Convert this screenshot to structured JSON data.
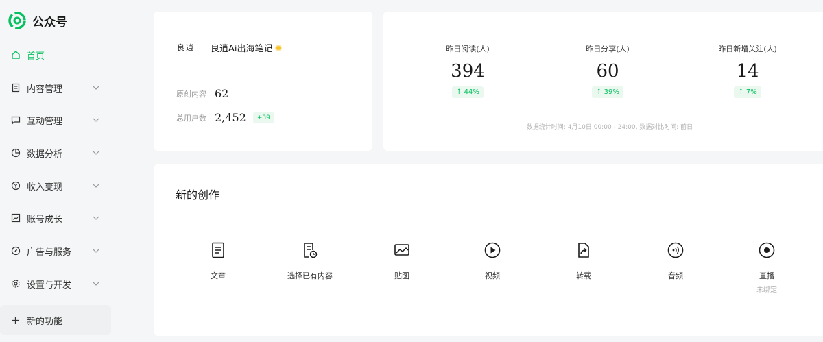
{
  "app": {
    "title": "公众号"
  },
  "sidebar": {
    "items": [
      {
        "label": "首页",
        "icon": "home-icon",
        "active": true
      },
      {
        "label": "内容管理",
        "icon": "document-icon"
      },
      {
        "label": "互动管理",
        "icon": "comment-icon"
      },
      {
        "label": "数据分析",
        "icon": "pie-chart-icon"
      },
      {
        "label": "收入变现",
        "icon": "yen-icon"
      },
      {
        "label": "账号成长",
        "icon": "trend-icon"
      },
      {
        "label": "广告与服务",
        "icon": "compass-icon"
      },
      {
        "label": "设置与开发",
        "icon": "gear-icon"
      }
    ],
    "new_func": {
      "label": "新的功能",
      "icon": "plus-icon"
    }
  },
  "account": {
    "avatar_text": "良逍",
    "name": "良逍Ai出海笔记",
    "original_label": "原创内容",
    "original_value": "62",
    "users_label": "总用户数",
    "users_value": "2,452",
    "users_delta": "+39"
  },
  "stats": {
    "items": [
      {
        "label": "昨日阅读(人)",
        "value": "394",
        "change": "↑ 44%"
      },
      {
        "label": "昨日分享(人)",
        "value": "60",
        "change": "↑ 39%"
      },
      {
        "label": "昨日新增关注(人)",
        "value": "14",
        "change": "↑ 7%"
      }
    ],
    "note": "数据统计时间: 4月10日 00:00 - 24:00, 数据对比时间: 前日"
  },
  "create": {
    "title": "新的创作",
    "items": [
      {
        "label": "文章",
        "icon": "article-icon"
      },
      {
        "label": "选择已有内容",
        "icon": "existing-content-icon"
      },
      {
        "label": "贴图",
        "icon": "image-icon"
      },
      {
        "label": "视频",
        "icon": "video-play-icon"
      },
      {
        "label": "转载",
        "icon": "repost-icon"
      },
      {
        "label": "音频",
        "icon": "audio-icon"
      },
      {
        "label": "直播",
        "icon": "live-icon",
        "sub": "未绑定"
      }
    ]
  },
  "colors": {
    "accent": "#07c160",
    "background": "#f5f6f7",
    "card": "#ffffff"
  }
}
